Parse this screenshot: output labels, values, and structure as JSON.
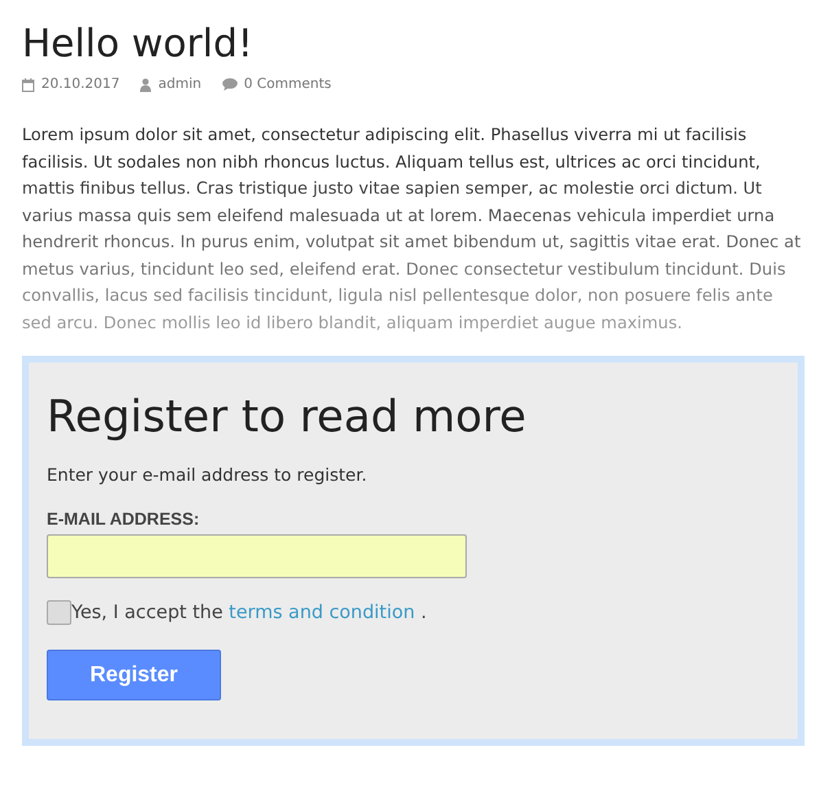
{
  "post": {
    "title": "Hello world!",
    "meta": {
      "date": "20.10.2017",
      "author": "admin",
      "comments": "0 Comments"
    },
    "excerpt": "Lorem ipsum dolor sit amet, consectetur adipiscing elit. Phasellus viverra mi ut facilisis facilisis. Ut sodales non nibh rhoncus luctus. Aliquam tellus est, ultrices ac orci tincidunt, mattis finibus tellus. Cras tristique justo vitae sapien semper, ac molestie orci dictum. Ut varius massa quis sem eleifend malesuada ut at lorem. Maecenas vehicula imperdiet urna hendrerit rhoncus. In purus enim, volutpat sit amet bibendum ut, sagittis vitae erat. Donec at metus varius, tincidunt leo sed, eleifend erat. Donec consectetur vestibulum tincidunt. Duis convallis, lacus sed facilisis tincidunt, ligula nisl pellentesque dolor, non posuere felis ante sed arcu. Donec mollis leo id libero blandit, aliquam imperdiet augue maximus."
  },
  "register": {
    "title": "Register to read more",
    "intro": "Enter your e-mail address to register.",
    "email_label": "E-MAIL ADDRESS:",
    "terms": {
      "checked": false,
      "before": "Yes, I accept the",
      "link": "terms and condition",
      "after": "."
    },
    "button": "Register"
  }
}
